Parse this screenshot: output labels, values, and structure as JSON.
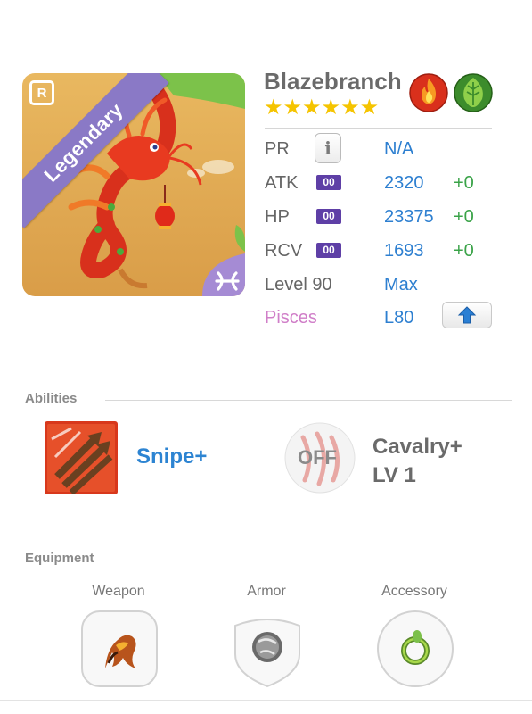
{
  "monster": {
    "name": "Blazebranch",
    "stars": "★★★★★★",
    "rarity": "Legendary",
    "rarity_icon": "R",
    "elements": [
      "fire-element-icon",
      "wood-element-icon"
    ],
    "sign_icon": "pisces-sign-icon"
  },
  "stats": {
    "pr": {
      "label": "PR",
      "value": "N/A",
      "button": "i"
    },
    "atk": {
      "label": "ATK",
      "badge": "00",
      "value": "2320",
      "bonus": "+0"
    },
    "hp": {
      "label": "HP",
      "badge": "00",
      "value": "23375",
      "bonus": "+0"
    },
    "rcv": {
      "label": "RCV",
      "badge": "00",
      "value": "1693",
      "bonus": "+0"
    },
    "level": {
      "label": "Level 90",
      "value": "Max"
    },
    "sign": {
      "label": "Pisces",
      "value": "L80",
      "button_icon": "arrow-up-icon"
    }
  },
  "abilities": {
    "title": "Abilities",
    "items": [
      {
        "name": "Snipe+",
        "icon": "snipe-arrows-icon"
      },
      {
        "name": "Cavalry+",
        "level": "LV 1",
        "state": "OFF",
        "icon": "claw-marks-icon"
      }
    ]
  },
  "equipment": {
    "title": "Equipment",
    "slots": [
      {
        "label": "Weapon",
        "icon": "fire-claw-weapon-icon"
      },
      {
        "label": "Armor",
        "icon": "stone-armor-icon"
      },
      {
        "label": "Accessory",
        "icon": "green-ring-accessory-icon"
      }
    ]
  },
  "colors": {
    "name_gray": "#6a6a6a",
    "value_blue": "#2d7fd0",
    "bonus_green": "#3aa348",
    "badge_purple": "#5e3fa6",
    "legendary_purple": "#8a79c6",
    "pisces_pink": "#d07ec8",
    "star_gold": "#f5c400"
  }
}
